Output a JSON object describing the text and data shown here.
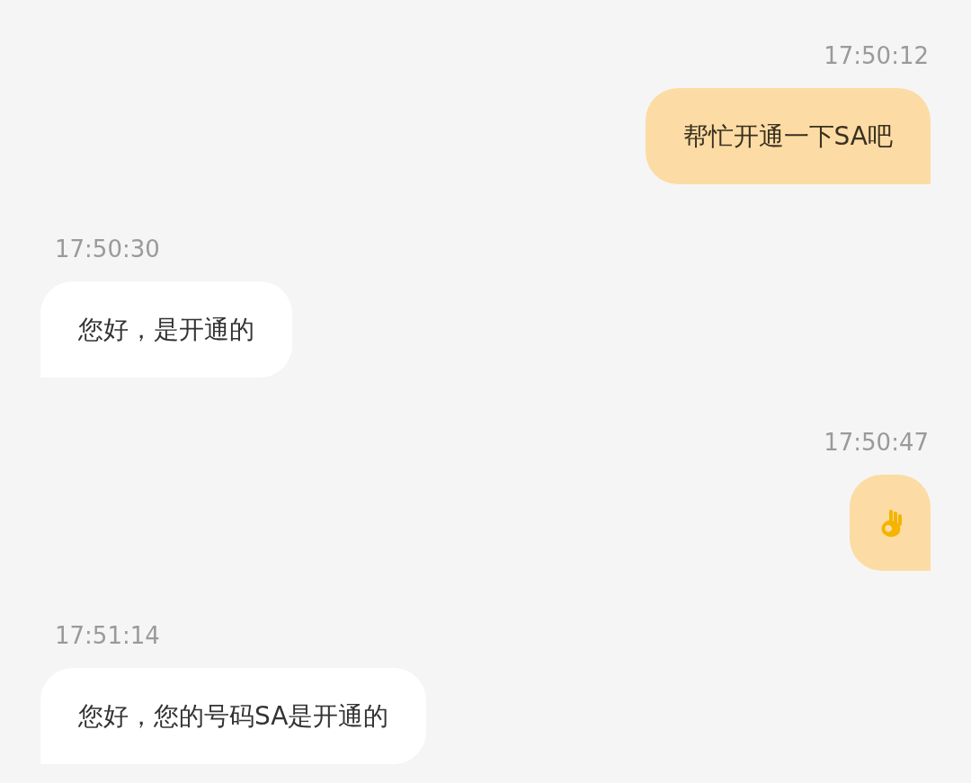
{
  "messages": [
    {
      "outgoing": true,
      "kind": "text",
      "time": "17:50:12",
      "text": "帮忙开通一下SA吧"
    },
    {
      "outgoing": false,
      "kind": "text",
      "time": "17:50:30",
      "text": "您好，是开通的"
    },
    {
      "outgoing": true,
      "kind": "emoji",
      "time": "17:50:47"
    },
    {
      "outgoing": false,
      "kind": "text",
      "time": "17:51:14",
      "text": "您好，您的号码SA是开通的"
    }
  ]
}
